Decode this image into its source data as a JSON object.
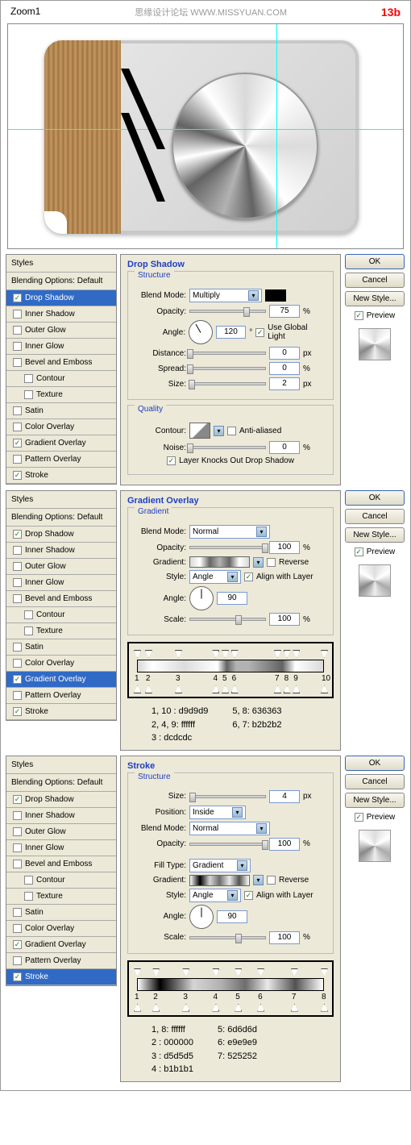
{
  "header": {
    "left": "Zoom1",
    "mid": "思缘设计论坛  WWW.MISSYUAN.COM",
    "right": "13b"
  },
  "styles_panel": {
    "title": "Styles",
    "blending": "Blending Options: Default",
    "items": [
      {
        "label": "Drop Shadow",
        "checked": true
      },
      {
        "label": "Inner Shadow",
        "checked": false
      },
      {
        "label": "Outer Glow",
        "checked": false
      },
      {
        "label": "Inner Glow",
        "checked": false
      },
      {
        "label": "Bevel and Emboss",
        "checked": false
      },
      {
        "label": "Contour",
        "checked": false,
        "indent": true
      },
      {
        "label": "Texture",
        "checked": false,
        "indent": true
      },
      {
        "label": "Satin",
        "checked": false
      },
      {
        "label": "Color Overlay",
        "checked": false
      },
      {
        "label": "Gradient Overlay",
        "checked": true
      },
      {
        "label": "Pattern Overlay",
        "checked": false
      },
      {
        "label": "Stroke",
        "checked": true
      }
    ]
  },
  "buttons": {
    "ok": "OK",
    "cancel": "Cancel",
    "newstyle": "New Style...",
    "preview": "Preview"
  },
  "drop_shadow": {
    "title": "Drop Shadow",
    "structure": "Structure",
    "quality": "Quality",
    "blend_mode_label": "Blend Mode:",
    "blend_mode": "Multiply",
    "opacity_label": "Opacity:",
    "opacity": "75",
    "pct": "%",
    "angle_label": "Angle:",
    "angle": "120",
    "deg": "°",
    "use_global": "Use Global Light",
    "distance_label": "Distance:",
    "distance": "0",
    "px": "px",
    "spread_label": "Spread:",
    "spread": "0",
    "size_label": "Size:",
    "size": "2",
    "contour_label": "Contour:",
    "anti": "Anti-aliased",
    "noise_label": "Noise:",
    "noise": "0",
    "knocks": "Layer Knocks Out Drop Shadow"
  },
  "gradient_overlay": {
    "title": "Gradient Overlay",
    "gradient_section": "Gradient",
    "blend_mode_label": "Blend Mode:",
    "blend_mode": "Normal",
    "opacity_label": "Opacity:",
    "opacity": "100",
    "pct": "%",
    "gradient_label": "Gradient:",
    "reverse": "Reverse",
    "style_label": "Style:",
    "style": "Angle",
    "align": "Align with Layer",
    "angle_label": "Angle:",
    "angle": "90",
    "scale_label": "Scale:",
    "scale": "100",
    "stops_nums": [
      "1",
      "2",
      "3",
      "4",
      "5",
      "6",
      "7",
      "8",
      "9",
      "10"
    ],
    "stops_pos": [
      0,
      6,
      22,
      42,
      47,
      52,
      75,
      80,
      85,
      100
    ],
    "legend": [
      [
        "1, 10  : d9d9d9",
        "2, 4, 9: ffffff",
        "3       : dcdcdc"
      ],
      [
        "5, 8: 636363",
        "6, 7: b2b2b2"
      ]
    ]
  },
  "stroke": {
    "title": "Stroke",
    "structure": "Structure",
    "size_label": "Size:",
    "size": "4",
    "px": "px",
    "position_label": "Position:",
    "position": "Inside",
    "blend_mode_label": "Blend Mode:",
    "blend_mode": "Normal",
    "opacity_label": "Opacity:",
    "opacity": "100",
    "pct": "%",
    "filltype_label": "Fill Type:",
    "filltype": "Gradient",
    "gradient_label": "Gradient:",
    "reverse": "Reverse",
    "style_label": "Style:",
    "style": "Angle",
    "align": "Align with Layer",
    "angle_label": "Angle:",
    "angle": "90",
    "scale_label": "Scale:",
    "scale": "100",
    "stops_nums": [
      "1",
      "2",
      "3",
      "4",
      "5",
      "6",
      "7",
      "8"
    ],
    "stops_pos": [
      0,
      10,
      26,
      42,
      54,
      66,
      84,
      100
    ],
    "legend": [
      [
        "1, 8: ffffff",
        "2   : 000000",
        "3   : d5d5d5",
        "4   : b1b1b1"
      ],
      [
        "5: 6d6d6d",
        "6: e9e9e9",
        "7: 525252"
      ]
    ]
  }
}
